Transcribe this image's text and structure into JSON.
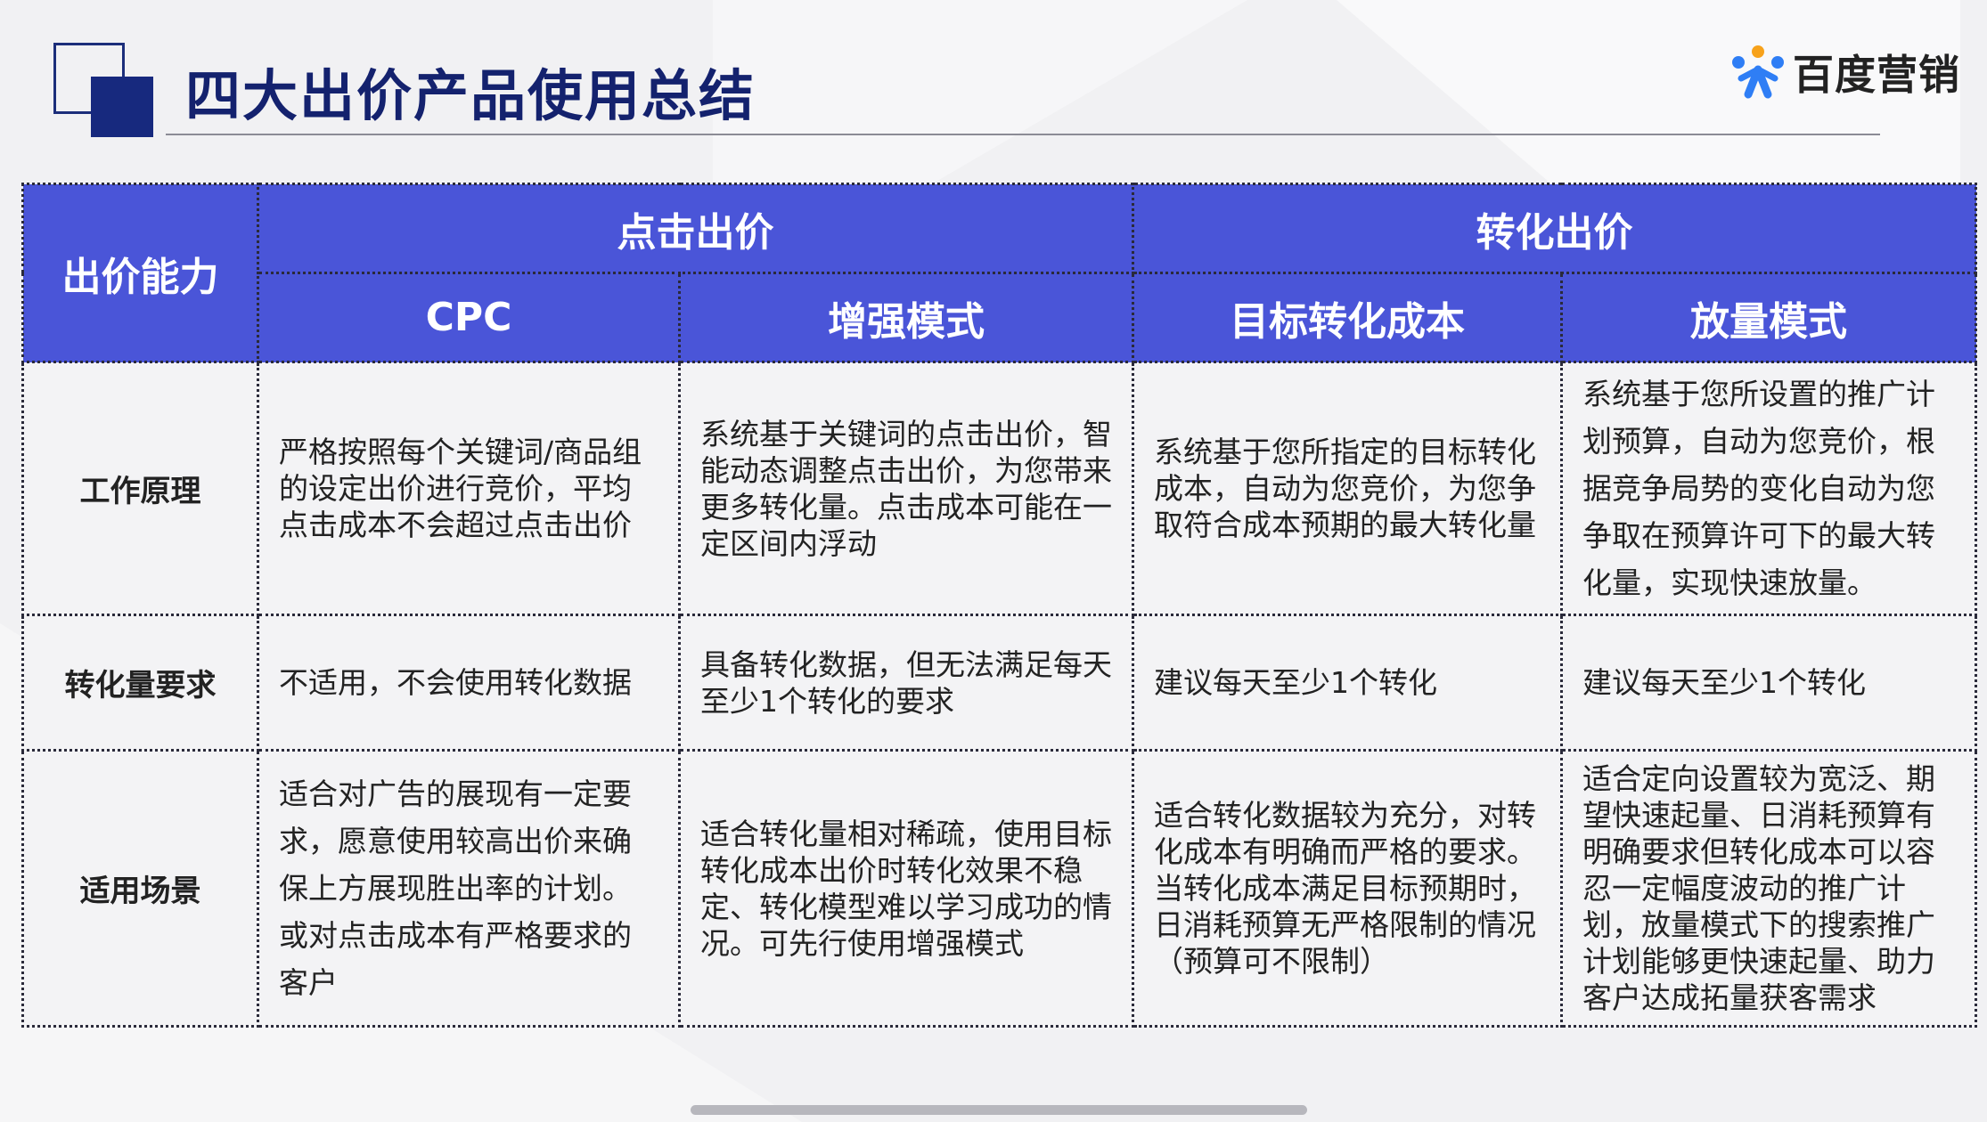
{
  "header": {
    "title": "四大出价产品使用总结",
    "brand_name": "百度营销",
    "brand_colors": {
      "blue": "#2f7ef5",
      "orange": "#f7a21b",
      "accent": "#4a55d8",
      "title": "#14226e"
    }
  },
  "table": {
    "corner_header": "出价能力",
    "groups": [
      {
        "label": "点击出价"
      },
      {
        "label": "转化出价"
      }
    ],
    "columns": [
      "CPC",
      "增强模式",
      "目标转化成本",
      "放量模式"
    ],
    "rows": [
      {
        "label": "工作原理",
        "cells": [
          "严格按照每个关键词/商品组的设定出价进行竞价，平均点击成本不会超过点击出价",
          "系统基于关键词的点击出价，智能动态调整点击出价，为您带来更多转化量。点击成本可能在一定区间内浮动",
          "系统基于您所指定的目标转化成本，自动为您竞价，为您争取符合成本预期的最大转化量",
          "系统基于您所设置的推广计划预算，自动为您竞价，根据竞争局势的变化自动为您争取在预算许可下的最大转化量，实现快速放量。"
        ]
      },
      {
        "label": "转化量要求",
        "cells": [
          "不适用，不会使用转化数据",
          "具备转化数据，但无法满足每天至少1个转化的要求",
          "建议每天至少1个转化",
          "建议每天至少1个转化"
        ]
      },
      {
        "label": "适用场景",
        "cells": [
          "适合对广告的展现有一定要求，愿意使用较高出价来确保上方展现胜出率的计划。或对点击成本有严格要求的客户",
          "适合转化量相对稀疏，使用目标转化成本出价时转化效果不稳定、转化模型难以学习成功的情况。可先行使用增强模式",
          "适合转化数据较为充分，对转化成本有明确而严格的要求。 当转化成本满足目标预期时，日消耗预算无严格限制的情况（预算可不限制）",
          "适合定向设置较为宽泛、期望快速起量、日消耗预算有明确要求但转化成本可以容忍一定幅度波动的推广计划，放量模式下的搜索推广计划能够更快速起量、助力客户达成拓量获客需求"
        ]
      }
    ]
  }
}
